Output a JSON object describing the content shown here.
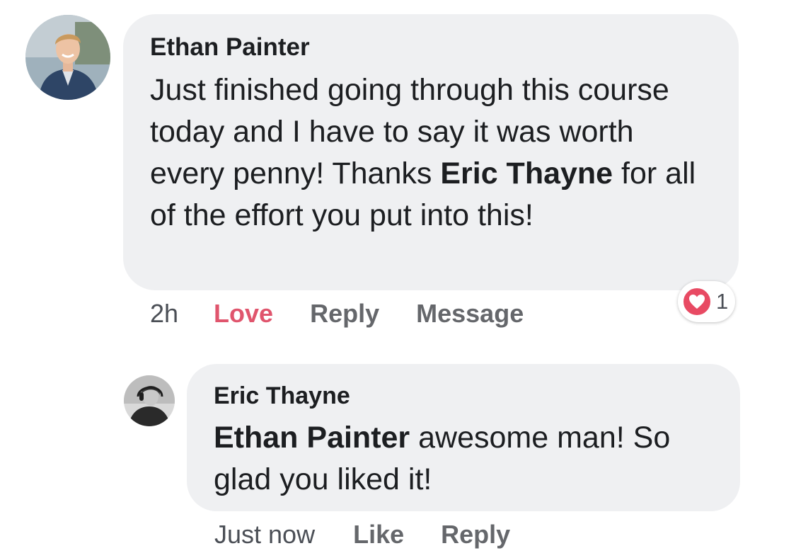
{
  "comments": [
    {
      "author": "Ethan Painter",
      "text_before": "Just finished going through this course today and I have to say it was worth every penny! Thanks ",
      "mention": "Eric Thayne",
      "text_after": " for all of the effort you put into this!",
      "time": "2h",
      "actions": {
        "love": "Love",
        "reply": "Reply",
        "message": "Message"
      },
      "reaction": {
        "icon": "heart-icon",
        "count": "1"
      }
    },
    {
      "author": "Eric Thayne",
      "mention": "Ethan Painter",
      "text_after": " awesome man! So glad you liked it!",
      "time": "Just now",
      "actions": {
        "like": "Like",
        "reply": "Reply"
      }
    }
  ],
  "colors": {
    "bubble": "#eff0f2",
    "love": "#e0556d",
    "action": "#65676b",
    "reaction_heart": "#e84a63"
  }
}
